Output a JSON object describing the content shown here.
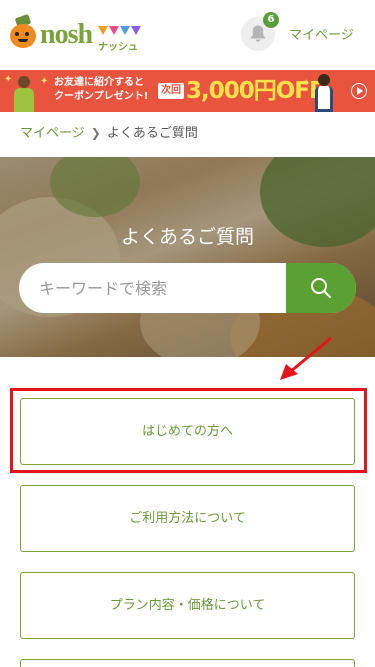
{
  "header": {
    "logo_text": "nosh",
    "logo_sub": "ナッシュ",
    "notification_count": "6",
    "mypage_label": "マイページ"
  },
  "banner": {
    "line1": "お友達に紹介すると",
    "line2": "クーポンプレゼント!",
    "tag": "次回",
    "amount": "3,000円OFF"
  },
  "breadcrumb": {
    "parent": "マイページ",
    "current": "よくあるご質問"
  },
  "hero": {
    "title": "よくあるご質問",
    "search_placeholder": "キーワードで検索"
  },
  "faq_buttons": [
    {
      "label": "はじめての方へ"
    },
    {
      "label": "ご利用方法について"
    },
    {
      "label": "プラン内容・価格について"
    },
    {
      "label": ""
    }
  ],
  "colors": {
    "brand_green": "#5aa033",
    "banner_red": "#e9543f",
    "highlight_red": "#e4141c"
  },
  "icons": [
    "bell-icon",
    "search-icon",
    "play-icon",
    "chevron-right-icon"
  ]
}
